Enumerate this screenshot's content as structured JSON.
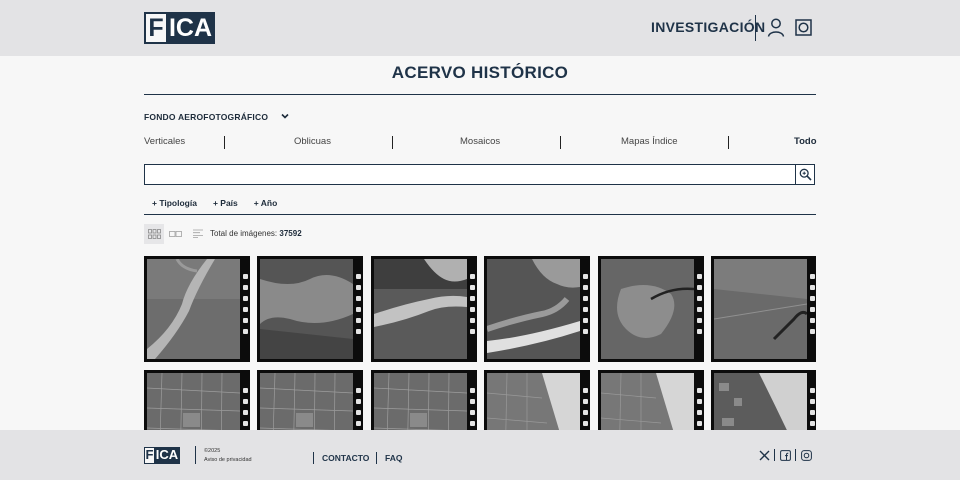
{
  "header": {
    "logo_f": "F",
    "logo_ica": "ICA",
    "nav_label": "INVESTIGACIÓN"
  },
  "page": {
    "title": "ACERVO HISTÓRICO"
  },
  "fondo": {
    "label": "FONDO AEROFOTOGRÁFICO"
  },
  "categories": [
    "Verticales",
    "Oblicuas",
    "Mosaicos",
    "Mapas Índice",
    "Todo"
  ],
  "search": {
    "value": "",
    "placeholder": ""
  },
  "filters": [
    "+ Tipología",
    "+ País",
    "+ Año"
  ],
  "results": {
    "total_label": "Total de imágenes:",
    "total_value": "37592"
  },
  "thumbnails": [
    {
      "pattern": "river"
    },
    {
      "pattern": "fields-dark"
    },
    {
      "pattern": "river-wide"
    },
    {
      "pattern": "coast"
    },
    {
      "pattern": "inlet"
    },
    {
      "pattern": "fields-river"
    },
    {
      "pattern": "grid-fields"
    },
    {
      "pattern": "grid-fields"
    },
    {
      "pattern": "grid-fields"
    },
    {
      "pattern": "beach"
    },
    {
      "pattern": "beach"
    },
    {
      "pattern": "beach-city"
    }
  ],
  "footer": {
    "logo_f": "F",
    "logo_ica": "ICA",
    "copyright": "©2025",
    "privacy": "Aviso de privacidad",
    "contact": "CONTACTO",
    "faq": "FAQ"
  },
  "colors": {
    "navy": "#1f3348",
    "header_bg": "#e3e3e5",
    "page_bg": "#f7f7f7"
  }
}
